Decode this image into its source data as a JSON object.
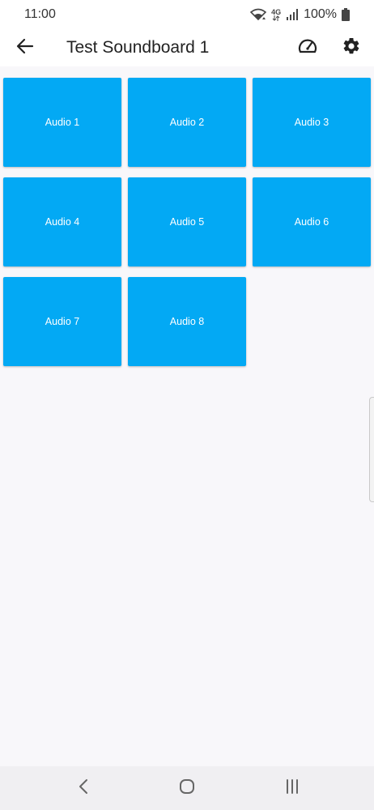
{
  "status_bar": {
    "time": "11:00",
    "network": "4G",
    "battery": "100%",
    "icons": [
      "wifi-icon",
      "4g-icon",
      "signal-icon",
      "battery-icon"
    ]
  },
  "app_bar": {
    "title": "Test Soundboard 1",
    "icons": [
      "back-arrow-icon",
      "speedometer-icon",
      "gear-icon"
    ]
  },
  "sounds": [
    {
      "label": "Audio 1"
    },
    {
      "label": "Audio 2"
    },
    {
      "label": "Audio 3"
    },
    {
      "label": "Audio 4"
    },
    {
      "label": "Audio 5"
    },
    {
      "label": "Audio 6"
    },
    {
      "label": "Audio 7"
    },
    {
      "label": "Audio 8"
    }
  ],
  "nav_bar": {
    "icons": [
      "back-icon",
      "home-icon",
      "recents-icon"
    ]
  },
  "colors": {
    "tile": "#03a9f4",
    "tile_text": "#ffffff",
    "background": "#f8f7fa",
    "toolbar": "#ffffff"
  }
}
